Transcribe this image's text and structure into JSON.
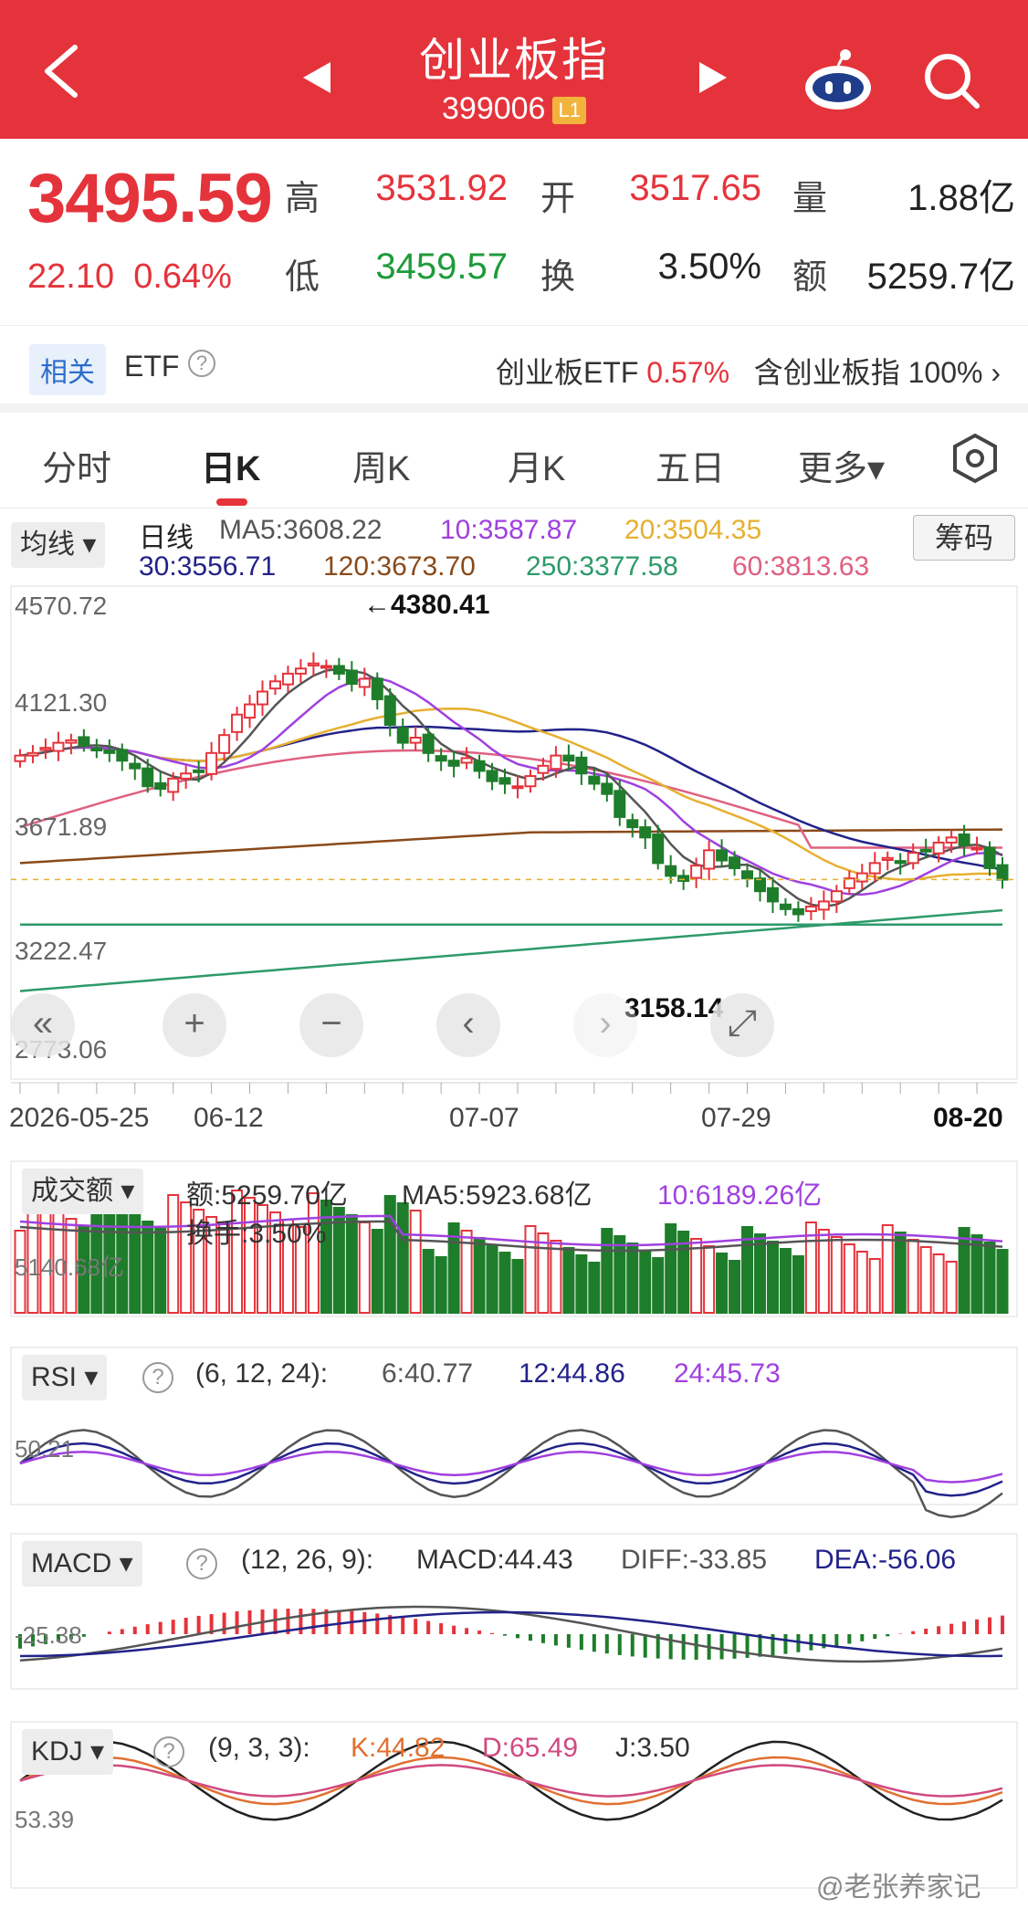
{
  "header": {
    "title": "创业板指",
    "code": "399006",
    "level": "L1"
  },
  "quote": {
    "price": "3495.59",
    "change": "22.10",
    "change_pct": "0.64%",
    "high_label": "高",
    "high": "3531.92",
    "open_label": "开",
    "open": "3517.65",
    "volume_label": "量",
    "volume": "1.88亿",
    "low_label": "低",
    "low": "3459.57",
    "turnover_label": "换",
    "turnover": "3.50%",
    "amount_label": "额",
    "amount": "5259.7亿"
  },
  "etf": {
    "tag": "相关",
    "label": "ETF",
    "name": "创业板ETF",
    "pct": "0.57%",
    "contain": "含创业板指 100%"
  },
  "tabs": [
    "分时",
    "日K",
    "周K",
    "月K",
    "五日",
    "更多▾"
  ],
  "active_tab": "日K",
  "kline": {
    "ma_button": "均线",
    "period": "日线",
    "chip_button": "筹码",
    "ma5": "MA5:3608.22",
    "ma10": "10:3587.87",
    "ma20": "20:3504.35",
    "ma30": "30:3556.71",
    "ma120": "120:3673.70",
    "ma250": "250:3377.58",
    "ma60": "60:3813.63",
    "y_ticks": [
      "4570.72",
      "4121.30",
      "3671.89",
      "3222.47",
      "2773.06"
    ],
    "high_marker": "←4380.41",
    "low_marker": "3158.14",
    "x_ticks": [
      "2026-05-25",
      "06-12",
      "07-07",
      "07-29",
      "08-20"
    ],
    "nav_buttons": [
      "«",
      "+",
      "−",
      "‹",
      "›",
      "⤢"
    ]
  },
  "volume_panel": {
    "button": "成交额",
    "amount": "额:5259.70亿",
    "ma5": "MA5:5923.68亿",
    "ma10": "10:6189.26亿",
    "turnover": "换手:3.50%",
    "axis": "5140.68亿"
  },
  "rsi_panel": {
    "button": "RSI",
    "params": "(6, 12, 24):",
    "r6": "6:40.77",
    "r12": "12:44.86",
    "r24": "24:45.73",
    "axis": "50.21"
  },
  "macd_panel": {
    "button": "MACD",
    "params": "(12, 26, 9):",
    "macd": "MACD:44.43",
    "diff": "DIFF:-33.85",
    "dea": "DEA:-56.06",
    "axis": "-25.38"
  },
  "kdj_panel": {
    "button": "KDJ",
    "params": "(9, 3, 3):",
    "k": "K:44.82",
    "d": "D:65.49",
    "j": "J:3.50",
    "axis": "53.39"
  },
  "watermark": "@老张养家记",
  "colors": {
    "red": "#e5333b",
    "green": "#1e7d2a",
    "ma5": "#555555",
    "ma10": "#a040e0",
    "ma20": "#e6b030",
    "ma30": "#22228a",
    "ma120": "#8a4a1a",
    "ma250": "#2e9a6a",
    "ma60": "#e06080"
  },
  "chart_data": {
    "type": "candlestick",
    "closes": [
      3980,
      3990,
      4010,
      4030,
      4040,
      4020,
      4000,
      3990,
      3960,
      3930,
      3860,
      3850,
      3890,
      3910,
      3920,
      3990,
      4060,
      4140,
      4180,
      4230,
      4270,
      4300,
      4320,
      4340,
      4330,
      4300,
      4260,
      4280,
      4200,
      4100,
      4030,
      4050,
      3990,
      3960,
      3940,
      3970,
      3920,
      3880,
      3870,
      3860,
      3900,
      3940,
      3980,
      3960,
      3910,
      3870,
      3830,
      3740,
      3700,
      3660,
      3560,
      3510,
      3490,
      3550,
      3610,
      3570,
      3540,
      3500,
      3450,
      3410,
      3380,
      3360,
      3390,
      3410,
      3450,
      3500,
      3520,
      3560,
      3580,
      3560,
      3600,
      3610,
      3640,
      3660,
      3630,
      3620,
      3540,
      3495
    ]
  }
}
